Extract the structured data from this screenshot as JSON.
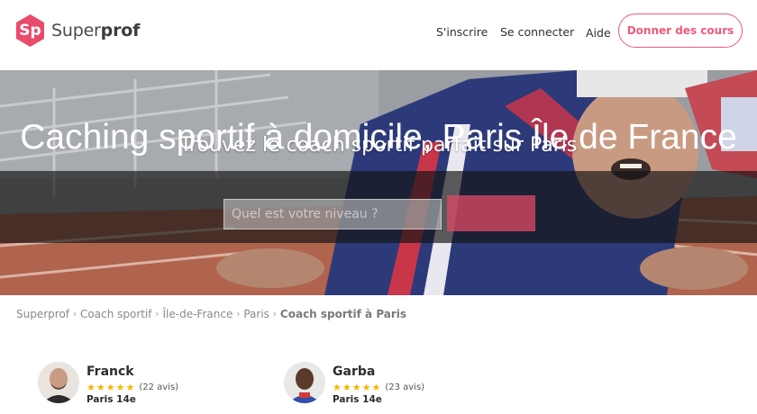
{
  "brand": {
    "badge": "Sp",
    "name_prefix": "Super",
    "name_suffix": "prof",
    "color": "#e94b6b"
  },
  "nav": {
    "signup": "S'inscrire",
    "login": "Se connecter",
    "help": "Aide",
    "cta": "Donner des cours"
  },
  "hero": {
    "title": "Trouvez le coach sportif parfait sur Paris",
    "search_placeholder": "Quel est votre niveau ?",
    "overlay_title": "Caching sportif à domicile, Paris Île de France"
  },
  "breadcrumb": [
    "Superprof",
    "Coach sportif",
    "Île-de-France",
    "Paris",
    "Coach sportif à Paris"
  ],
  "coaches": [
    {
      "name": "Franck",
      "stars": "★★★★★",
      "reviews": "(22 avis)",
      "location": "Paris 14e"
    },
    {
      "name": "Garba",
      "stars": "★★★★★",
      "reviews": "(23 avis)",
      "location": "Paris 14e"
    }
  ],
  "colors": {
    "accent": "#f05a7a",
    "star": "#f7b500"
  }
}
